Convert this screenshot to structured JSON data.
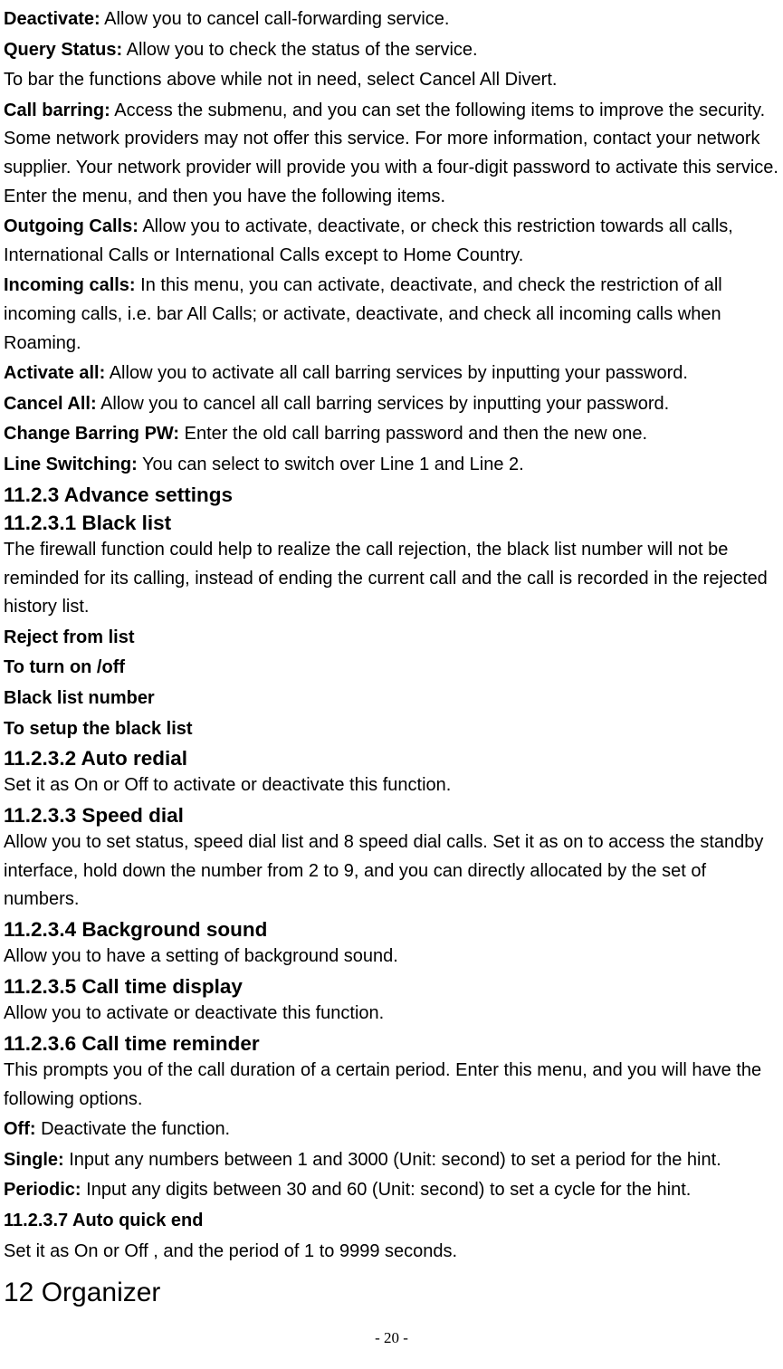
{
  "p": [
    {
      "label": "Deactivate:",
      "text": " Allow you to cancel call-forwarding service."
    },
    {
      "label": "Query Status:",
      "text": " Allow you to check the status of the service."
    },
    {
      "label": "",
      "text": "To bar the functions above while not in need, select Cancel All Divert."
    },
    {
      "label": "Call barring:",
      "text": " Access the submenu, and you can set the following items to improve the security. Some network providers may not offer this service. For more information, contact your network supplier. Your network provider will provide you with a four-digit password to activate this service. Enter the menu, and then you have the following items."
    },
    {
      "label": "Outgoing Calls:",
      "text": " Allow you to activate, deactivate, or check this restriction towards all calls, International Calls or International Calls except to Home Country."
    },
    {
      "label": "Incoming calls:",
      "text": " In this menu, you can activate, deactivate, and check the restriction of all incoming calls, i.e. bar All Calls; or activate, deactivate, and check all incoming calls when Roaming."
    },
    {
      "label": "Activate all:",
      "text": " Allow you to activate all call barring services by inputting your password."
    },
    {
      "label": "Cancel All:",
      "text": " Allow you to cancel all call barring services by inputting your password."
    },
    {
      "label": "Change Barring PW:",
      "text": " Enter the old call barring password and then the new one."
    },
    {
      "label": "Line Switching:",
      "text": " You can select to switch over Line 1 and Line 2."
    }
  ],
  "h_1123": "11.2.3 Advance settings",
  "h_11231": "11.2.3.1 Black list",
  "blacklist_para": "The firewall function could help to realize the call rejection, the black list number will not be reminded for its calling, instead of ending the current call and the call is recorded in the rejected history list.",
  "bl_lines": [
    "Reject from list",
    "To turn on /off",
    "Black list number",
    "To setup the black list"
  ],
  "h_11232": "11.2.3.2 Auto redial",
  "auto_redial_para": "Set it as On or Off to activate or deactivate this function.",
  "h_11233": "11.2.3.3 Speed dial",
  "speed_dial_para": "Allow you to set status, speed dial list and 8 speed dial calls. Set it as on to access the standby interface, hold down the number from 2 to 9, and you can directly allocated by the set of numbers.",
  "h_11234": "11.2.3.4 Background sound",
  "bg_sound_para": "Allow you to have a setting of background sound.",
  "h_11235": "11.2.3.5 Call time display",
  "ctd_para": "Allow you to activate or deactivate this function.",
  "h_11236": "11.2.3.6 Call time reminder",
  "ctr_para": "This prompts you of the call duration of a certain period. Enter this menu, and you will have the following options.",
  "ctr_items": [
    {
      "label": "Off:",
      "text": " Deactivate the function."
    },
    {
      "label": "Single:",
      "text": " Input any numbers between 1 and 3000 (Unit: second) to set a period for the hint."
    },
    {
      "label": "Periodic:",
      "text": " Input any digits between 30 and 60 (Unit: second) to set a cycle for the hint."
    }
  ],
  "h_11237": "11.2.3.7 Auto quick end",
  "aqe_para": "Set it as On or Off , and the period of 1 to 9999 seconds.",
  "h_12": "12 Organizer",
  "page_num": "- 20 -"
}
